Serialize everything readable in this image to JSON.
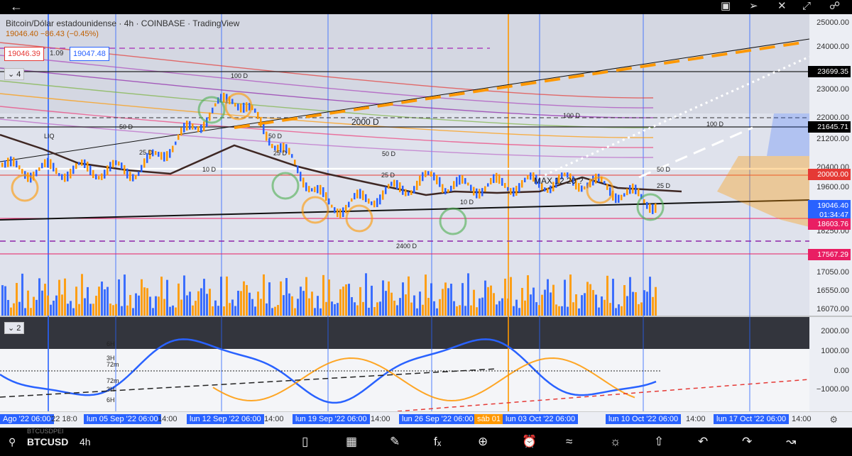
{
  "window": {
    "back_icon": "arrow-left-icon",
    "top_icons": [
      "screenshot-icon",
      "pin-icon",
      "close-icon",
      "expand-icon",
      "share-icon"
    ]
  },
  "legend": {
    "title": "Bitcoin/Dólar estadounidense · 4h · COINBASE · TradingView",
    "change": "19046.40  −86.43 (−0.45%)",
    "bid": "19046.39",
    "spread": "1.09",
    "ask": "19047.48"
  },
  "panels": {
    "main_index": "4",
    "osc_index": "2"
  },
  "price_axis": [
    "25000.00",
    "24000.00",
    "23000.00",
    "22000.00",
    "21200.00",
    "20400.00",
    "19600.00",
    "18250.00",
    "17050.00",
    "16550.00",
    "16070.00"
  ],
  "price_tags": [
    {
      "label": "23699.35",
      "color": "#000000",
      "text_color": "#ffffff"
    },
    {
      "label": "21645.71",
      "color": "#000000",
      "text_color": "#ffffff"
    },
    {
      "label": "20000.00",
      "color": "#e53935",
      "text_color": "#ffffff"
    },
    {
      "label": "19046.40",
      "color": "#2962ff",
      "text_color": "#ffffff"
    },
    {
      "label": "01:34:47",
      "color": "#2962ff",
      "text_color": "#ffffff"
    },
    {
      "label": "18603.76",
      "color": "#e91e63",
      "text_color": "#ffffff"
    },
    {
      "label": "17567.29",
      "color": "#e91e63",
      "text_color": "#ffffff"
    }
  ],
  "osc_axis": [
    "2000.00",
    "1000.00",
    "0.00",
    "−1000.00"
  ],
  "chart_annotations": {
    "d100_a": "100 D",
    "d100_b": "100 D",
    "d100_c": "100 D",
    "d2000": "2000 D",
    "d2400": "2400 D",
    "d50_a": "50 D",
    "d50_b": "50 D",
    "d50_c": "50 D",
    "d50_d": "50 D",
    "d25_a": "25 D",
    "d25_b": "25 D",
    "d25_c": "25 D",
    "d25_d": "25 D",
    "d10_a": "10 D",
    "d10_b": "10 D",
    "liq": "LIQ",
    "max": "MAX 12  20 ?",
    "h6_top": "6H",
    "h3_top": "3H",
    "m72_top": "72m",
    "m72_bot": "72m",
    "h3_bot": "3H",
    "h6_bot": "6H"
  },
  "time_axis": [
    {
      "label": "Ago '22  06:00",
      "style": "hl"
    },
    {
      "label": "'22  18:0",
      "style": "plain"
    },
    {
      "label": "lun 05 Sep '22  06:00",
      "style": "hl"
    },
    {
      "label": "14:00",
      "style": "plain"
    },
    {
      "label": "lun 12 Sep '22  06:00",
      "style": "hl"
    },
    {
      "label": "14:00",
      "style": "plain"
    },
    {
      "label": "lun 19 Sep '22  06:00",
      "style": "hl"
    },
    {
      "label": "14:00",
      "style": "plain"
    },
    {
      "label": "lun 26 Sep '22  06:00",
      "style": "hl"
    },
    {
      "label": "sáb 01 O",
      "style": "or"
    },
    {
      "label": "lun 03 Oct '22  06:00",
      "style": "hl"
    },
    {
      "label": "lun 10 Oct '22  06:00",
      "style": "hl"
    },
    {
      "label": "14:00",
      "style": "plain"
    },
    {
      "label": "lun 17 Oct '22  06:00",
      "style": "hl"
    },
    {
      "label": "14:00",
      "style": "plain"
    }
  ],
  "bottom": {
    "symbol": "BTCUSD",
    "symbol_ghost": "BTCUSDPEI",
    "timeframe": "4h",
    "tools": [
      "candles-icon",
      "compare-icon",
      "draw-pencil-icon",
      "indicators-fx-icon",
      "add-plus-icon",
      "alert-clock-icon",
      "chart-type-icon",
      "ideas-lightbulb-icon",
      "share-upload-icon",
      "undo-icon",
      "redo-icon",
      "trade-icon"
    ]
  },
  "colors": {
    "blue_bar": "#2962ff",
    "orange_bar": "#ff9800",
    "vline_orange": "#ff9800",
    "vline_blue": "#2962ff"
  }
}
